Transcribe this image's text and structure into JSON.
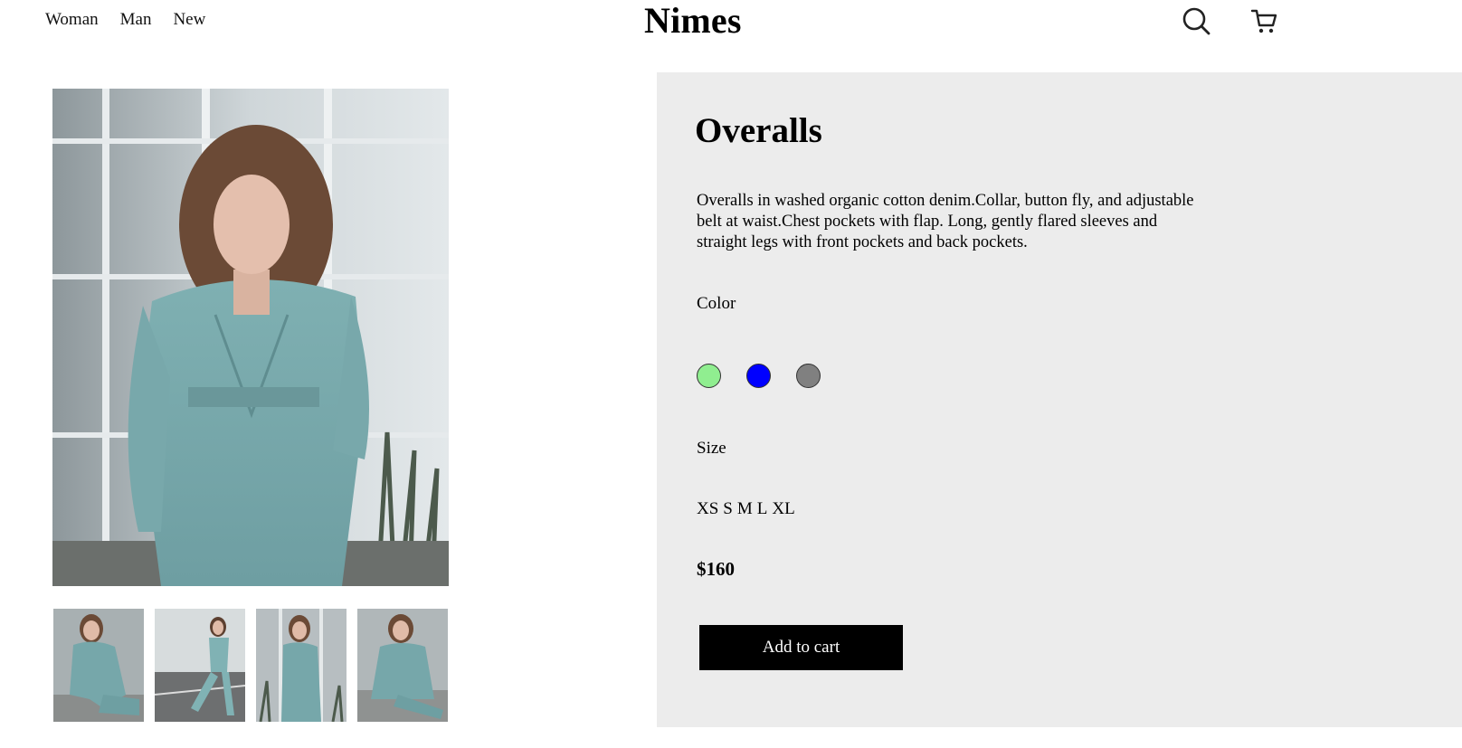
{
  "nav": {
    "items": [
      {
        "label": "Woman"
      },
      {
        "label": "Man"
      },
      {
        "label": "New"
      }
    ]
  },
  "brand": "Nimes",
  "icons": {
    "search": "search-icon",
    "cart": "cart-icon"
  },
  "gallery": {
    "main_image": "woman-in-denim-jumpsuit-photo",
    "thumbnails": [
      "denim-jumpsuit-sitting-photo",
      "denim-jumpsuit-walking-photo",
      "denim-jumpsuit-side-photo",
      "denim-jumpsuit-crouching-photo"
    ]
  },
  "product": {
    "title": "Overalls",
    "description": "Overalls in washed organic cotton denim.Collar, button fly, and adjustable belt at waist.Chest pockets with flap. Long, gently flared sleeves and straight legs with front pockets and back pockets.",
    "color_label": "Color",
    "colors": [
      "#90ee90",
      "#0000ff",
      "#808080"
    ],
    "size_label": "Size",
    "sizes": [
      "XS",
      "S",
      "M",
      "L",
      "XL"
    ],
    "price": "$160",
    "add_to_cart_label": "Add to cart"
  },
  "theme": {
    "panel_bg": "#ececec",
    "button_bg": "#000000",
    "button_text": "#ffffff"
  }
}
